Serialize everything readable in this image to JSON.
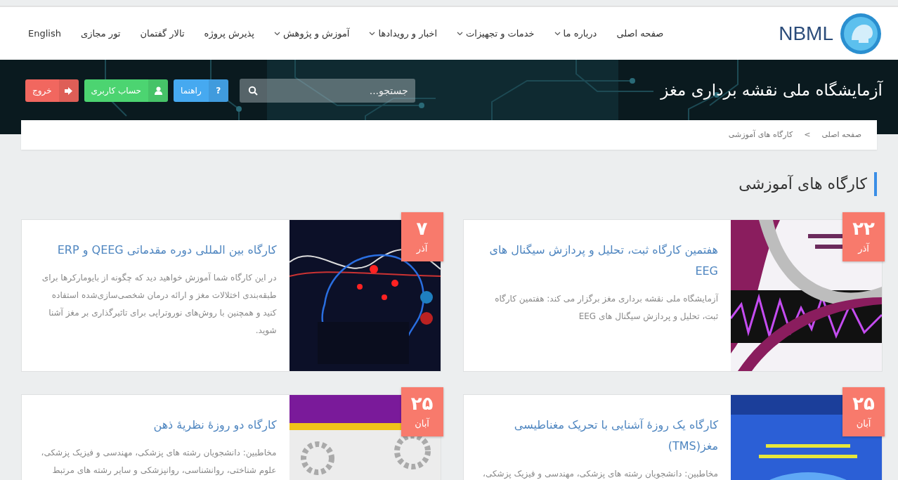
{
  "logo": {
    "text": "NBML"
  },
  "nav": [
    {
      "label": "صفحه اصلی",
      "dropdown": false
    },
    {
      "label": "درباره ما",
      "dropdown": true
    },
    {
      "label": "خدمات و تجهیزات",
      "dropdown": true
    },
    {
      "label": "اخبار و رویدادها",
      "dropdown": true
    },
    {
      "label": "آموزش و پژوهش",
      "dropdown": true
    },
    {
      "label": "پذیرش پروژه",
      "dropdown": false
    },
    {
      "label": "تالار گفتمان",
      "dropdown": false
    },
    {
      "label": "تور مجازی",
      "dropdown": false
    },
    {
      "label": "English",
      "dropdown": false
    }
  ],
  "banner": {
    "title": "آزمایشگاه ملی نقشه برداری مغز",
    "search": {
      "placeholder": "جستجو..."
    },
    "buttons": [
      {
        "kind": "help",
        "label": "راهنما",
        "glyph": "?"
      },
      {
        "kind": "account",
        "label": "حساب کاربری"
      },
      {
        "kind": "logout",
        "label": "خروج"
      }
    ]
  },
  "breadcrumb": {
    "items": [
      "صفحه اصلی",
      "کارگاه های آموزشی"
    ],
    "separator": ">"
  },
  "section_title": "کارگاه های آموزشی",
  "workshops": [
    {
      "day": "۲۲",
      "month": "آذر",
      "title": "هفتمین کارگاه ثبت، تحلیل و پردازش سیگنال های EEG",
      "summary": "آزمایشگاه ملی نقشه برداری مغز برگزار می کند: هفتمین کارگاه ثبت، تحلیل و پردازش سیگنال های EEG"
    },
    {
      "day": "۷",
      "month": "آذر",
      "title": "کارگاه بین المللی دوره مقدماتی QEEG و ERP",
      "summary": "در این کارگاه شما آموزش خواهید دید که چگونه از بایومارکرها برای طبقه‌بندی اختلالات مغز و ارائه درمان شخصی‌سازی‌شده استفاده کنید و همچنین با روش‌های نوروتراپی برای تاثیرگذاری بر مغز آشنا شوید."
    },
    {
      "day": "۲۵",
      "month": "آبان",
      "title": "کارگاه یک روزهٔ آشنایی با تحریک مغناطیسی مغز(TMS)",
      "summary": "مخاطبین: دانشجویان رشته های پزشکی، مهندسی و فیزیک پزشکی،"
    },
    {
      "day": "۲۵",
      "month": "آبان",
      "title": "کارگاه دو روزهٔ نظریهٔ ذهن",
      "summary": "مخاطبین: دانشجویان رشته های پزشکی، مهندسی و فیزیک پزشکی، علوم شناختی، روانشناسی، روانپزشکی و سایر رشته های مرتبط"
    }
  ]
}
